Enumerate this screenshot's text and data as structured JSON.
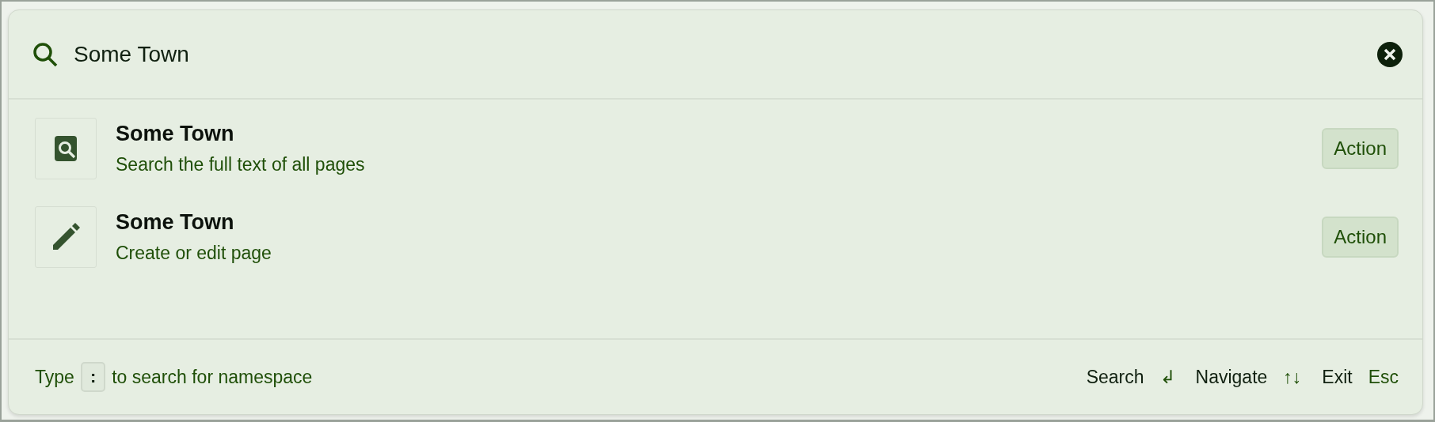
{
  "search": {
    "value": "Some Town"
  },
  "results": [
    {
      "kind": "fulltext",
      "title": "Some Town",
      "subtitle": "Search the full text of all pages",
      "action": "Action"
    },
    {
      "kind": "edit",
      "title": "Some Town",
      "subtitle": "Create or edit page",
      "action": "Action"
    }
  ],
  "footer": {
    "hint_before": "Type",
    "hint_key": ":",
    "hint_after": "to search for namespace",
    "shortcuts": [
      {
        "label": "Search",
        "key": "↲"
      },
      {
        "label": "Navigate",
        "key": "↑↓"
      },
      {
        "label": "Exit",
        "key": "Esc"
      }
    ]
  }
}
